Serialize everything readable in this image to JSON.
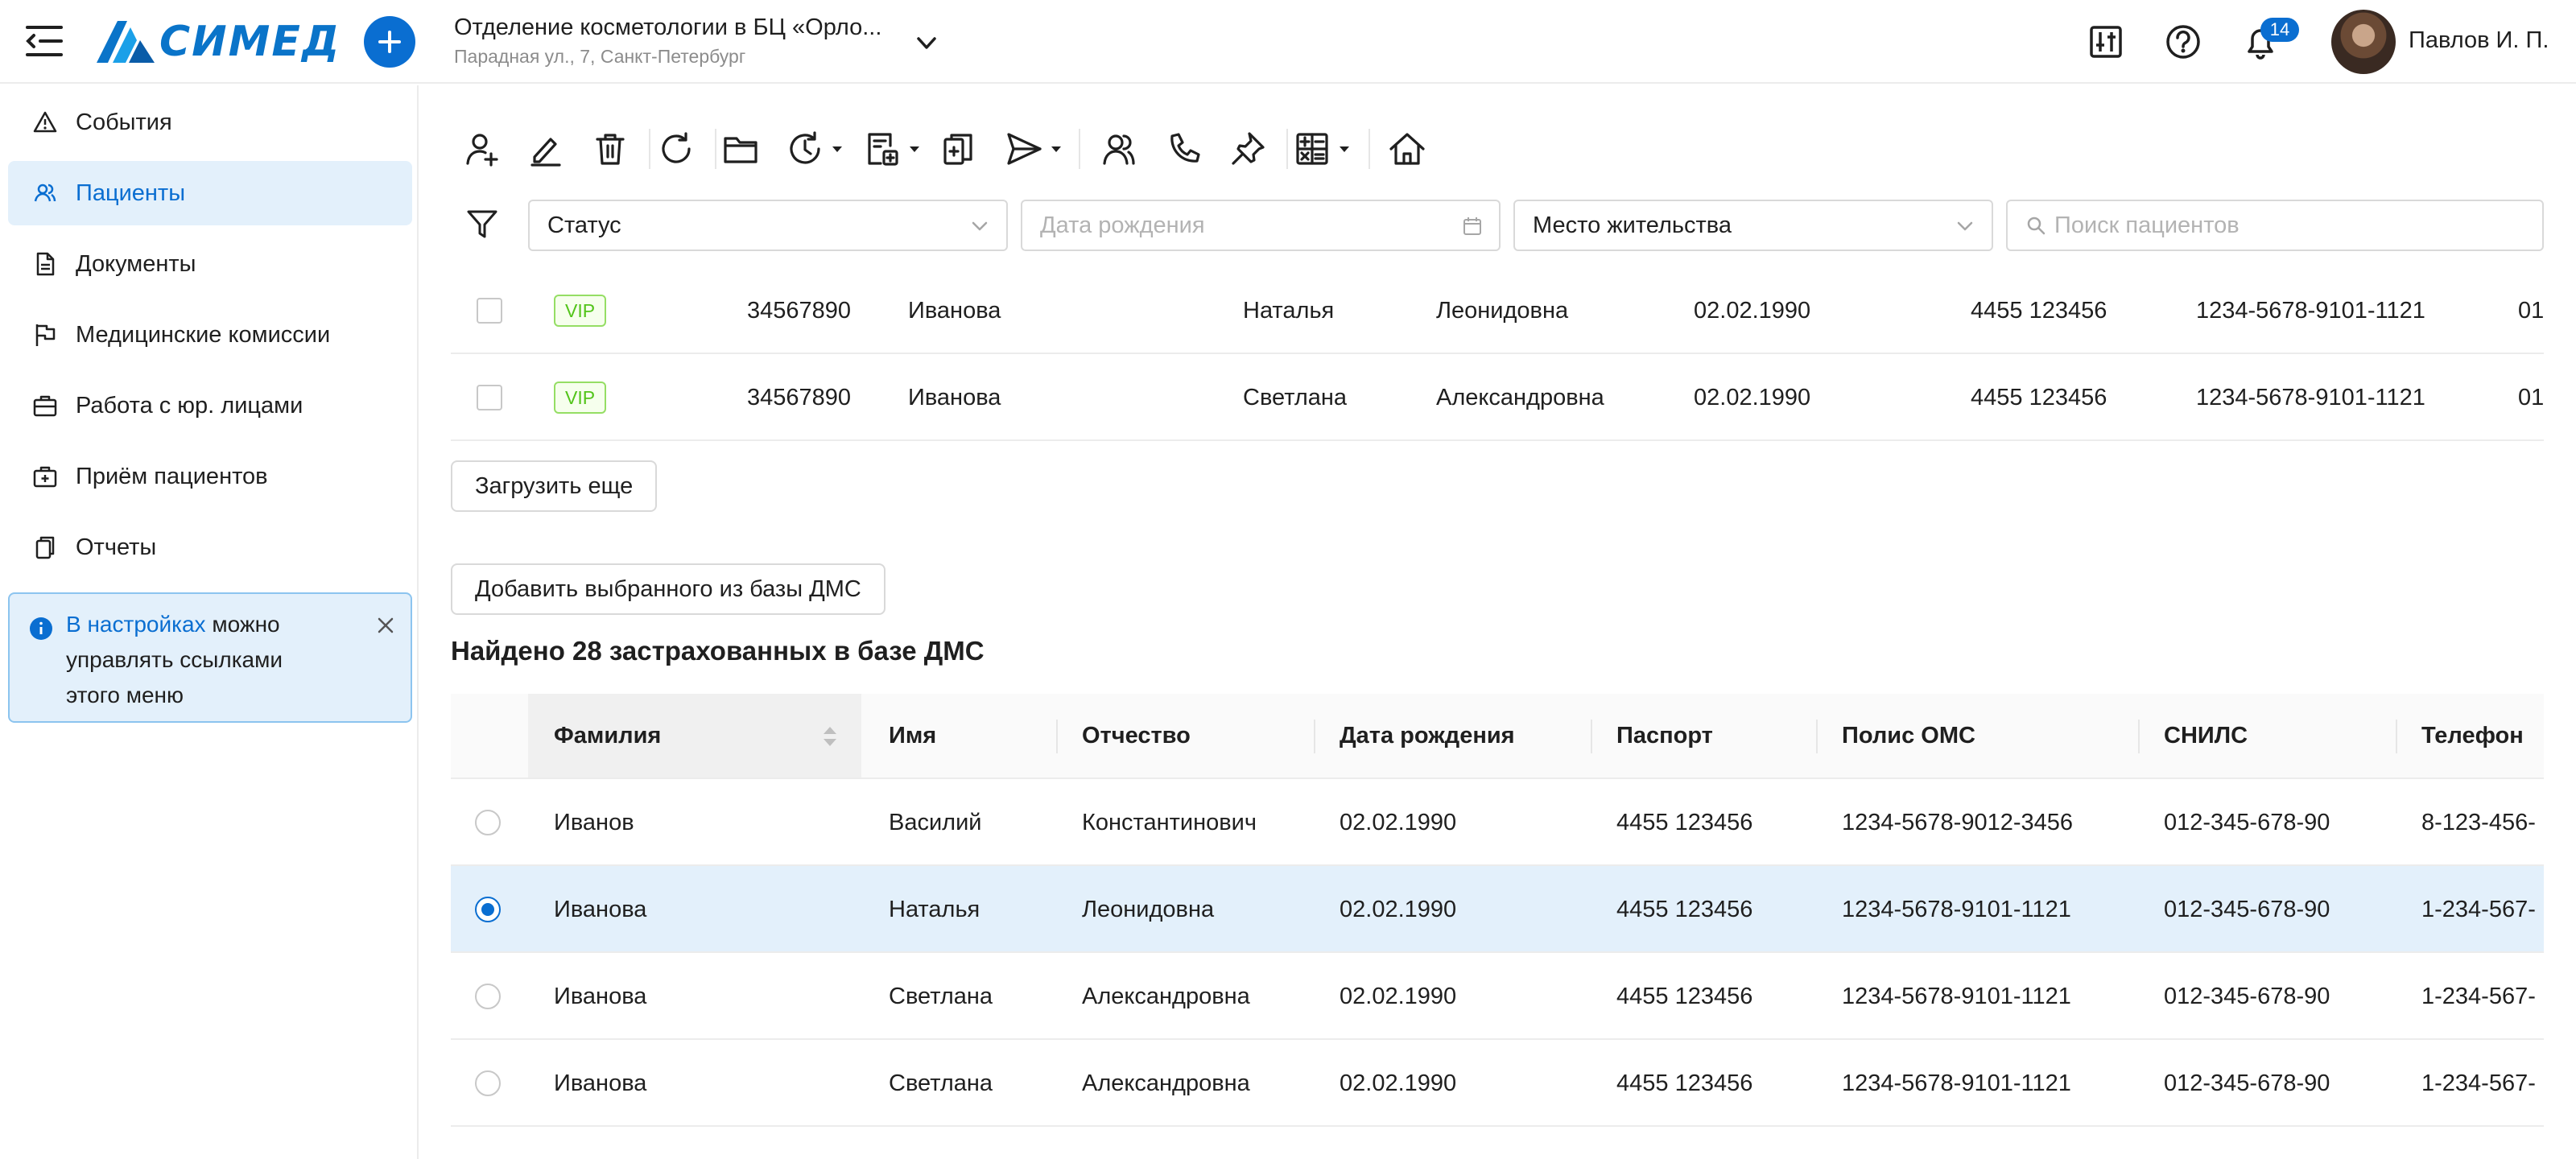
{
  "header": {
    "logo_text": "СИМЕД",
    "department_title": "Отделение косметологии в БЦ «Орло...",
    "department_address": "Парадная ул., 7, Санкт-Петербург",
    "notifications_count": "14",
    "user_name": "Павлов И. П.",
    "accent_color": "#0a6ed1"
  },
  "sidebar": {
    "items": [
      {
        "label": "События",
        "icon": "warning-icon"
      },
      {
        "label": "Пациенты",
        "icon": "patients-icon",
        "active": true
      },
      {
        "label": "Документы",
        "icon": "document-icon"
      },
      {
        "label": "Медицинские комиссии",
        "icon": "flag-icon"
      },
      {
        "label": "Работа с юр. лицами",
        "icon": "briefcase-icon"
      },
      {
        "label": "Приём пациентов",
        "icon": "medical-bag-icon"
      },
      {
        "label": "Отчеты",
        "icon": "reports-icon"
      }
    ],
    "hint": {
      "link": "В настройках",
      "text": " можно управлять ссылками этого меню"
    }
  },
  "filters": {
    "status": "Статус",
    "birth_date_placeholder": "Дата рождения",
    "residence": "Место жительства",
    "search_placeholder": "Поиск пациентов"
  },
  "patients": {
    "rows": [
      {
        "badge": "VIP",
        "id": "34567890",
        "last": "Иванова",
        "first": "Наталья",
        "middle": "Леонидовна",
        "dob": "02.02.1990",
        "passport": "4455 123456",
        "policy": "1234-5678-9101-1121",
        "extra": "01"
      },
      {
        "badge": "VIP",
        "id": "34567890",
        "last": "Иванова",
        "first": "Светлана",
        "middle": "Александровна",
        "dob": "02.02.1990",
        "passport": "4455 123456",
        "policy": "1234-5678-9101-1121",
        "extra": "01"
      }
    ],
    "load_more": "Загрузить еще"
  },
  "dms": {
    "add_button": "Добавить выбранного из базы ДМС",
    "found_title": "Найдено 28 застрахованных в базе ДМС",
    "columns": [
      "Фамилия",
      "Имя",
      "Отчество",
      "Дата рождения",
      "Паспорт",
      "Полис ОМС",
      "СНИЛС",
      "Телефон"
    ],
    "rows": [
      {
        "last": "Иванов",
        "first": "Василий",
        "middle": "Константинович",
        "dob": "02.02.1990",
        "passport": "4455 123456",
        "policy": "1234-5678-9012-3456",
        "snils": "012-345-678-90",
        "phone": "8-123-456-"
      },
      {
        "last": "Иванова",
        "first": "Наталья",
        "middle": "Леонидовна",
        "dob": "02.02.1990",
        "passport": "4455 123456",
        "policy": "1234-5678-9101-1121",
        "snils": "012-345-678-90",
        "phone": "1-234-567-",
        "selected": true
      },
      {
        "last": "Иванова",
        "first": "Светлана",
        "middle": "Александровна",
        "dob": "02.02.1990",
        "passport": "4455 123456",
        "policy": "1234-5678-9101-1121",
        "snils": "012-345-678-90",
        "phone": "1-234-567-"
      },
      {
        "last": "Иванова",
        "first": "Светлана",
        "middle": "Александровна",
        "dob": "02.02.1990",
        "passport": "4455 123456",
        "policy": "1234-5678-9101-1121",
        "snils": "012-345-678-90",
        "phone": "1-234-567-"
      }
    ]
  }
}
